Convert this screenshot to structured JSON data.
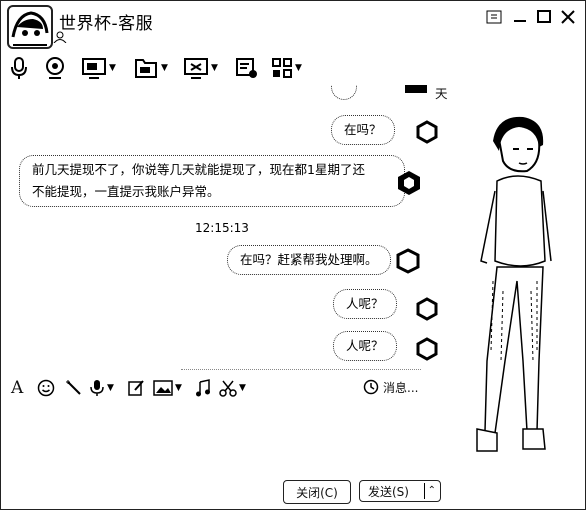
{
  "window": {
    "title": "世界杯-客服"
  },
  "chat": {
    "messages": [
      {
        "text": "在吗？"
      },
      {
        "text_line1": "前几天提现不了，你说等几天就能提现了，现在都1星期了还",
        "text_line2": "不能提现，一直提示我账户异常。"
      },
      {
        "timestamp": "12:15:13"
      },
      {
        "text": "在吗？赶紧帮我处理啊。"
      },
      {
        "text": "人呢？"
      },
      {
        "text": "人呢？"
      }
    ],
    "partial_top": "天"
  },
  "format_bar": {
    "history_label": "消息..."
  },
  "buttons": {
    "close_label": "关闭(C)",
    "send_label": "发送(S)"
  },
  "icons": [
    "app-avatar-icon",
    "microphone-icon",
    "video-call-icon",
    "remote-desktop-icon",
    "file-transfer-icon",
    "screen-share-icon",
    "apply-icon",
    "apps-icon",
    "font-icon",
    "emoji-icon",
    "magic-icon",
    "voice-icon",
    "edit-icon",
    "image-icon",
    "music-icon",
    "screenshot-icon",
    "clock-icon"
  ]
}
